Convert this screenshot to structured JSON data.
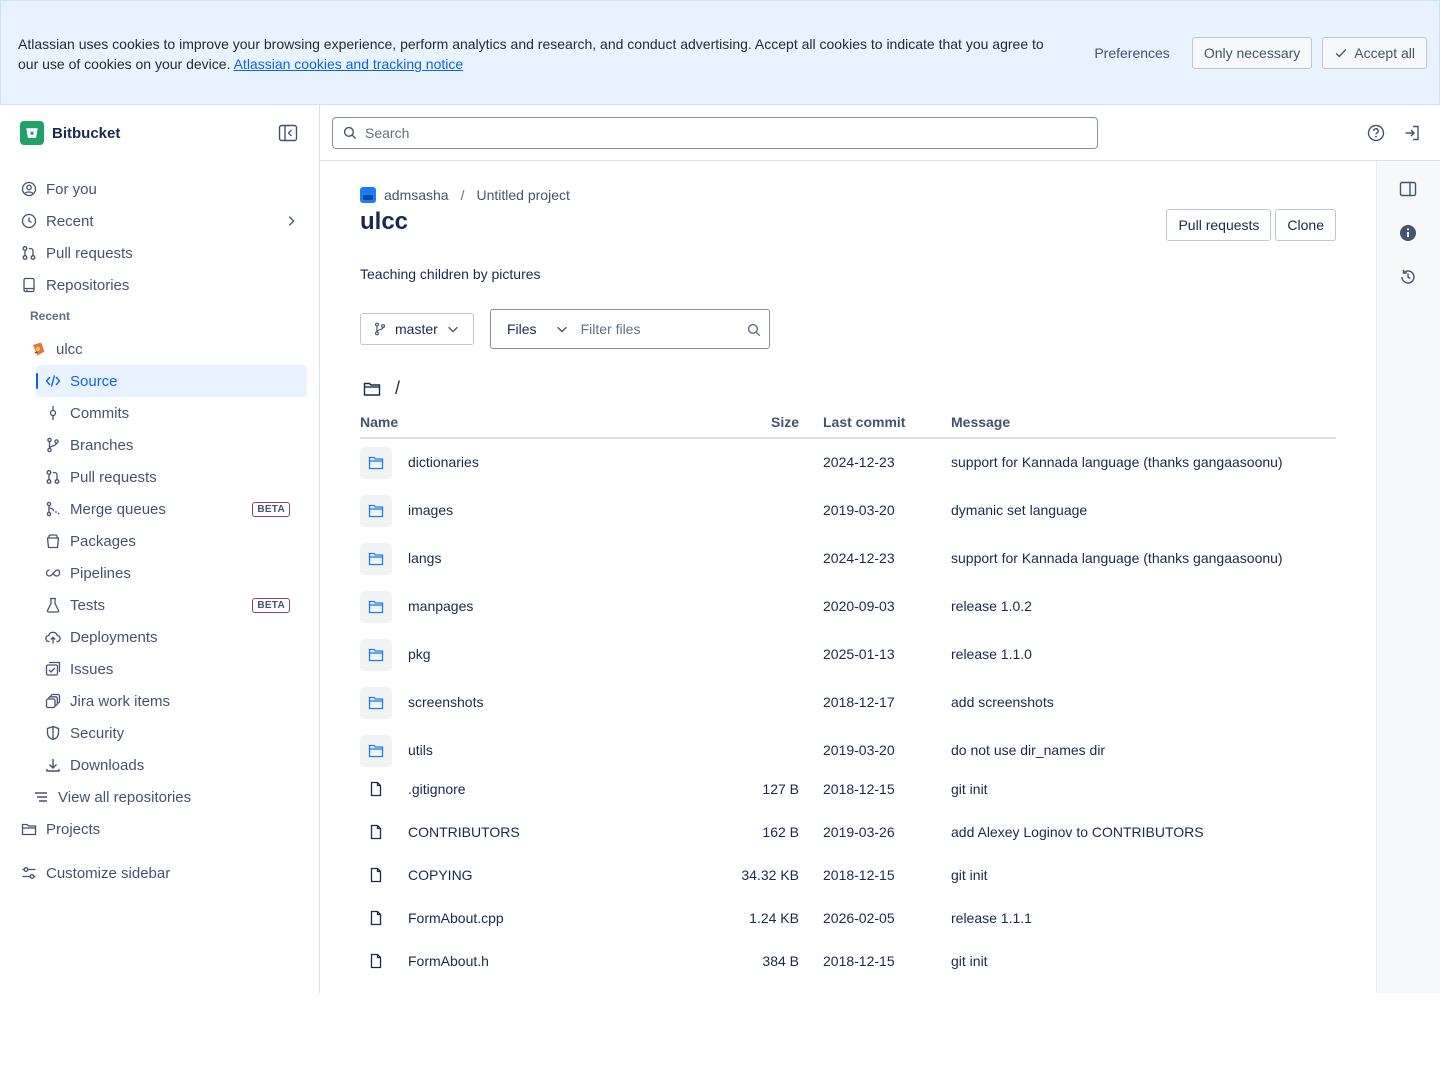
{
  "cookie_banner": {
    "text": "Atlassian uses cookies to improve your browsing experience, perform analytics and research, and conduct advertising. Accept all cookies to indicate that you agree to our use of cookies on your device.",
    "link_label": "Atlassian cookies and tracking notice",
    "preferences_label": "Preferences",
    "only_necessary_label": "Only necessary",
    "accept_all_label": "Accept all"
  },
  "brand": {
    "name": "Bitbucket",
    "accent": "#22a06b"
  },
  "sidebar": {
    "for_you": "For you",
    "recent": "Recent",
    "pull_requests": "Pull requests",
    "repositories": "Repositories",
    "recent_label": "Recent",
    "repo_name": "ulcc",
    "repo_items": [
      {
        "label": "Source",
        "icon": "code-icon",
        "active": true
      },
      {
        "label": "Commits",
        "icon": "commit-icon"
      },
      {
        "label": "Branches",
        "icon": "branch-icon"
      },
      {
        "label": "Pull requests",
        "icon": "pull-request-icon"
      },
      {
        "label": "Merge queues",
        "icon": "merge-queue-icon",
        "badge": "BETA"
      },
      {
        "label": "Packages",
        "icon": "package-icon"
      },
      {
        "label": "Pipelines",
        "icon": "pipeline-icon"
      },
      {
        "label": "Tests",
        "icon": "flask-icon",
        "badge": "BETA"
      },
      {
        "label": "Deployments",
        "icon": "cloud-upload-icon"
      },
      {
        "label": "Issues",
        "icon": "issues-icon"
      },
      {
        "label": "Jira work items",
        "icon": "jira-icon"
      },
      {
        "label": "Security",
        "icon": "shield-icon"
      },
      {
        "label": "Downloads",
        "icon": "download-icon"
      }
    ],
    "view_all": "View all repositories",
    "projects": "Projects",
    "customize": "Customize sidebar"
  },
  "search": {
    "placeholder": "Search"
  },
  "breadcrumb": {
    "workspace": "admsasha",
    "project": "Untitled project"
  },
  "repo": {
    "title": "ulcc",
    "description": "Teaching children by pictures",
    "pull_requests_btn": "Pull requests",
    "clone_btn": "Clone"
  },
  "branch": {
    "selected": "master"
  },
  "files_filter": {
    "mode": "Files",
    "placeholder": "Filter files"
  },
  "path": "/",
  "table": {
    "headers": {
      "name": "Name",
      "size": "Size",
      "last_commit": "Last commit",
      "message": "Message"
    },
    "rows": [
      {
        "type": "folder",
        "name": "dictionaries",
        "size": "",
        "date": "2024-12-23",
        "message": "support for Kannada language (thanks gangaasoonu)"
      },
      {
        "type": "folder",
        "name": "images",
        "size": "",
        "date": "2019-03-20",
        "message": "dymanic set language"
      },
      {
        "type": "folder",
        "name": "langs",
        "size": "",
        "date": "2024-12-23",
        "message": "support for Kannada language (thanks gangaasoonu)"
      },
      {
        "type": "folder",
        "name": "manpages",
        "size": "",
        "date": "2020-09-03",
        "message": "release 1.0.2"
      },
      {
        "type": "folder",
        "name": "pkg",
        "size": "",
        "date": "2025-01-13",
        "message": "release 1.1.0"
      },
      {
        "type": "folder",
        "name": "screenshots",
        "size": "",
        "date": "2018-12-17",
        "message": "add screenshots"
      },
      {
        "type": "folder",
        "name": "utils",
        "size": "",
        "date": "2019-03-20",
        "message": "do not use dir_names dir"
      },
      {
        "type": "file",
        "name": ".gitignore",
        "size": "127 B",
        "date": "2018-12-15",
        "message": "git init"
      },
      {
        "type": "file",
        "name": "CONTRIBUTORS",
        "size": "162 B",
        "date": "2019-03-26",
        "message": "add Alexey Loginov to CONTRIBUTORS"
      },
      {
        "type": "file",
        "name": "COPYING",
        "size": "34.32 KB",
        "date": "2018-12-15",
        "message": "git init"
      },
      {
        "type": "file",
        "name": "FormAbout.cpp",
        "size": "1.24 KB",
        "date": "2026-02-05",
        "message": "release 1.1.1"
      },
      {
        "type": "file",
        "name": "FormAbout.h",
        "size": "384 B",
        "date": "2018-12-15",
        "message": "git init"
      }
    ]
  }
}
